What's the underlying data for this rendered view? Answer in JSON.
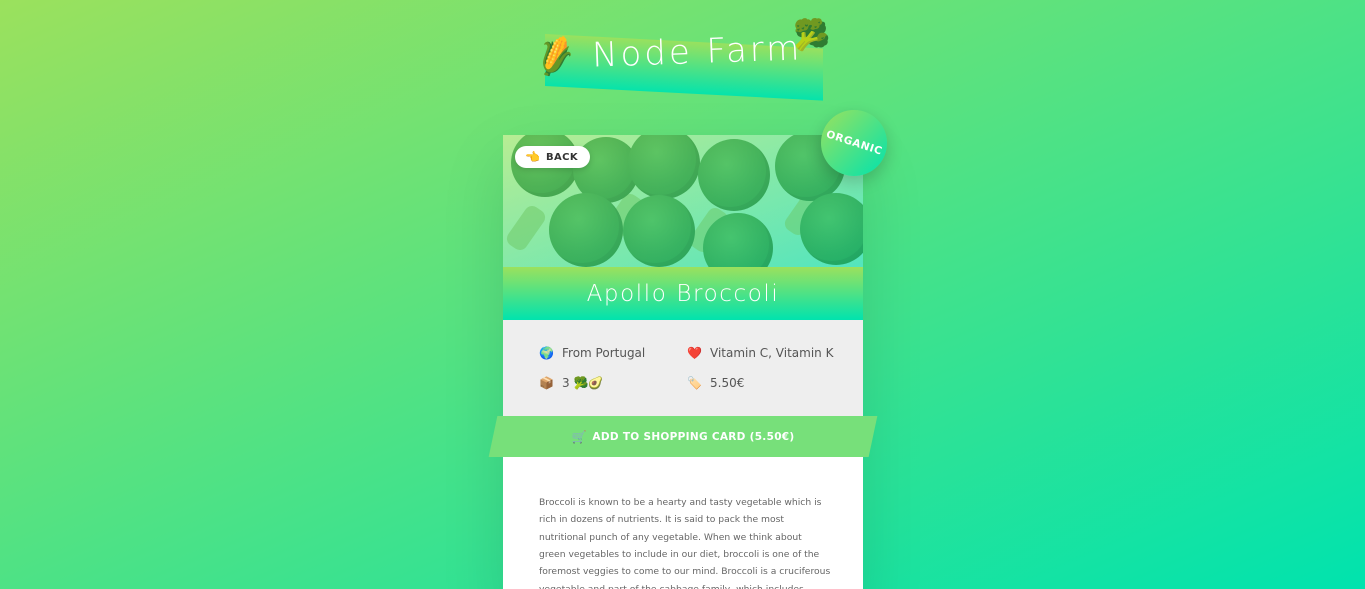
{
  "header": {
    "logo_text": "Node Farm",
    "left_emoji": "🌽",
    "right_emoji": "🥦"
  },
  "product": {
    "back_icon": "👈",
    "back_label": "BACK",
    "badge": "ORGANIC",
    "name": "Apollo Broccoli",
    "from_icon": "🌍",
    "from": "From Portugal",
    "nutrients_icon": "❤️",
    "nutrients": "Vitamin C, Vitamin K",
    "quantity_icon": "📦",
    "quantity": "3 🥦🥑",
    "price_icon": "🏷️",
    "price": "5.50€",
    "cart_icon": "🛒",
    "add_to_cart_label": "ADD TO SHOPPING CARD (5.50€)",
    "description": "Broccoli is known to be a hearty and tasty vegetable which is rich in dozens of nutrients. It is said to pack the most nutritional punch of any vegetable. When we think about green vegetables to include in our diet, broccoli is one of the foremost veggies to come to our mind. Broccoli is a cruciferous vegetable and part of the cabbage family, which includes vegetables such as Brussel sprouts"
  },
  "colors": {
    "gradient_start": "#9be15d",
    "gradient_end": "#00e3ae",
    "button": "#77e07a"
  }
}
